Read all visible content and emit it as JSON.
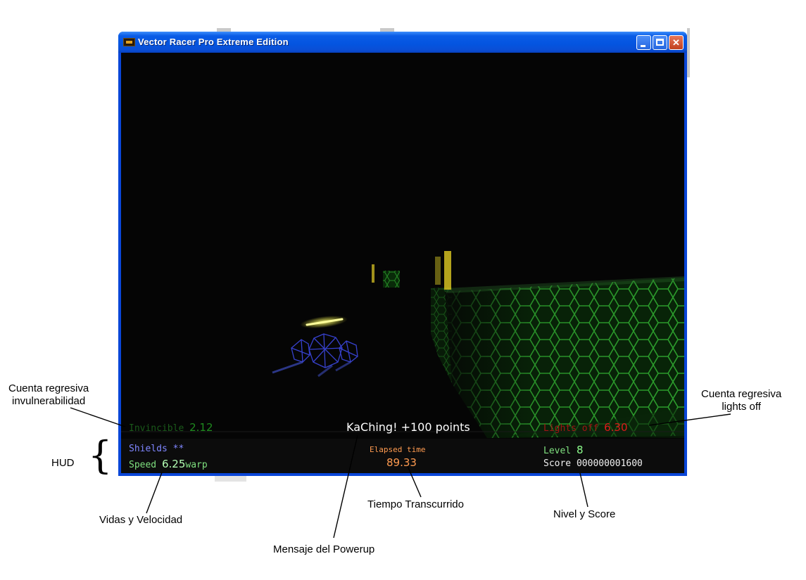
{
  "window": {
    "title": "Vector Racer Pro Extreme Edition",
    "controls": [
      "minimize",
      "maximize",
      "close"
    ]
  },
  "hud": {
    "invincible_label": "Invincible",
    "invincible_value": "2.12",
    "powerup_message": "KaChing! +100 points",
    "lights_off_label": "Lights off",
    "lights_off_value": "6.30",
    "shields_label": "Shields",
    "shields_value": "**",
    "speed_label": "Speed",
    "speed_value": "6.25",
    "speed_unit": "warp",
    "elapsed_label": "Elapsed time",
    "elapsed_value": "89.33",
    "level_label": "Level",
    "level_value": "8",
    "score_label": "Score",
    "score_value": "000000001600"
  },
  "annotations": {
    "invulnerability_line1": "Cuenta regresiva",
    "invulnerability_line2": "invulnerabilidad",
    "lights_off_line1": "Cuenta regresiva",
    "lights_off_line2": "lights off",
    "hud": "HUD",
    "hud_brace": "{",
    "lives_speed": "Vidas y Velocidad",
    "elapsed": "Tiempo Transcurrido",
    "powerup": "Mensaje del Powerup",
    "level_score": "Nivel y Score"
  },
  "colors": {
    "invincible": "#1e8a1e",
    "lights_off": "#e01a1a",
    "shields": "#7f86ff",
    "speed": "#7fe07f",
    "elapsed": "#ff9b50",
    "level": "#7fe07f",
    "score": "#f0f0f0",
    "message": "#ffffff",
    "wall": "#1fa81f"
  }
}
